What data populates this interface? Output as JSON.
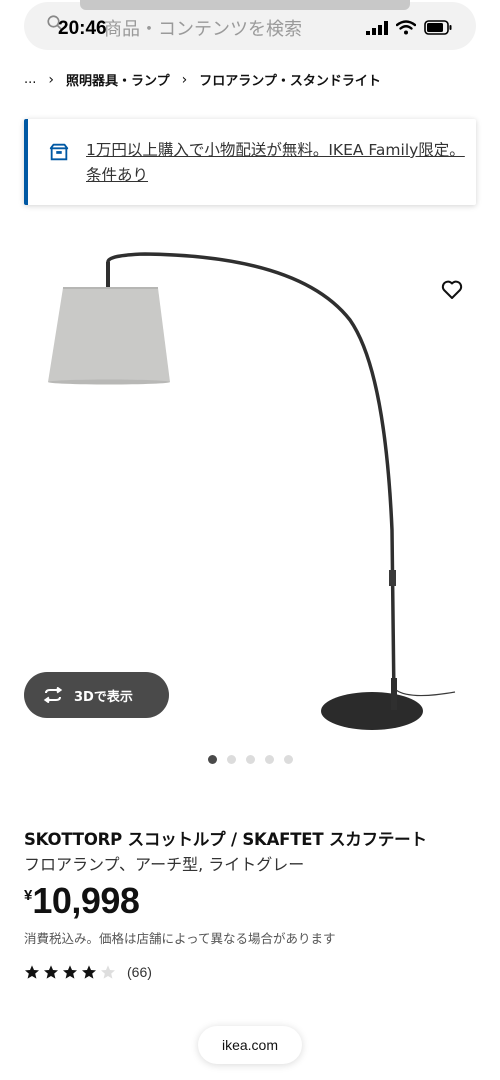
{
  "status_bar": {
    "time": "20:46"
  },
  "search": {
    "placeholder": "商品・コンテンツを検索"
  },
  "breadcrumb": {
    "ellipsis": "...",
    "items": [
      "照明器具・ランプ",
      "フロアランプ・スタンドライト"
    ]
  },
  "promo": {
    "text": "1万円以上購入で小物配送が無料。IKEA Family限定。条件あり"
  },
  "gallery": {
    "view3d_label": "3Dで表示",
    "dot_count": 5,
    "active_dot": 0
  },
  "product": {
    "name": "SKOTTORP スコットルプ / SKAFTET スカフテート",
    "description": "フロアランプ、アーチ型, ライトグレー",
    "currency": "¥",
    "price": "10,998",
    "price_note": "消費税込み。価格は店舗によって異なる場合があります",
    "rating_stars": 4,
    "rating_max": 5,
    "review_count": "(66)"
  },
  "url_bar": {
    "domain": "ikea.com"
  },
  "colors": {
    "accent": "#0058a3",
    "dark_button": "#4a4a4a"
  }
}
